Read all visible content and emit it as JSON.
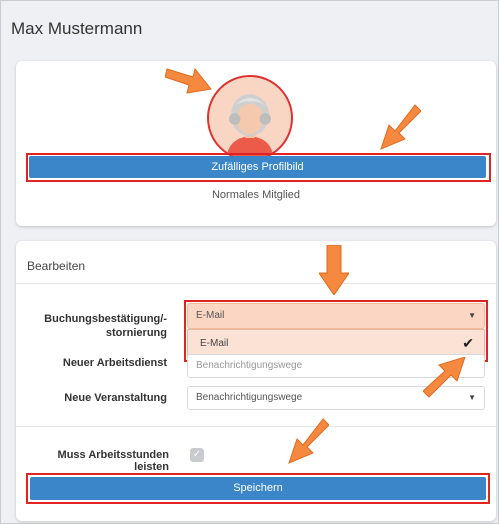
{
  "header": {
    "title": "Max Mustermann"
  },
  "profile": {
    "random_picture_button": "Zufälliges Profilbild",
    "member_type": "Normales Mitglied"
  },
  "edit": {
    "section_title": "Bearbeiten",
    "fields": [
      {
        "label": "Buchungsbestätigung/-\nstornierung",
        "value": "E-Mail"
      },
      {
        "label": "Neuer Arbeitsdienst",
        "placeholder": "Benachrichtigungswege"
      },
      {
        "label": "Neue Veranstaltung",
        "placeholder": "Benachrichtigungswege"
      }
    ],
    "dropdown_option": "E-Mail",
    "checkbox_label": "Muss Arbeitsstunden leisten",
    "save_button": "Speichern"
  },
  "colors": {
    "primary": "#3a86c8",
    "highlight": "#e02424",
    "arrow": "#f5893f",
    "dropdown_selected": "#fbd6c2"
  },
  "icons": {
    "avatar": "grandmother-avatar",
    "check": "checkmark-icon",
    "caret": "caret-down-icon",
    "arrows": "annotation-arrow"
  }
}
